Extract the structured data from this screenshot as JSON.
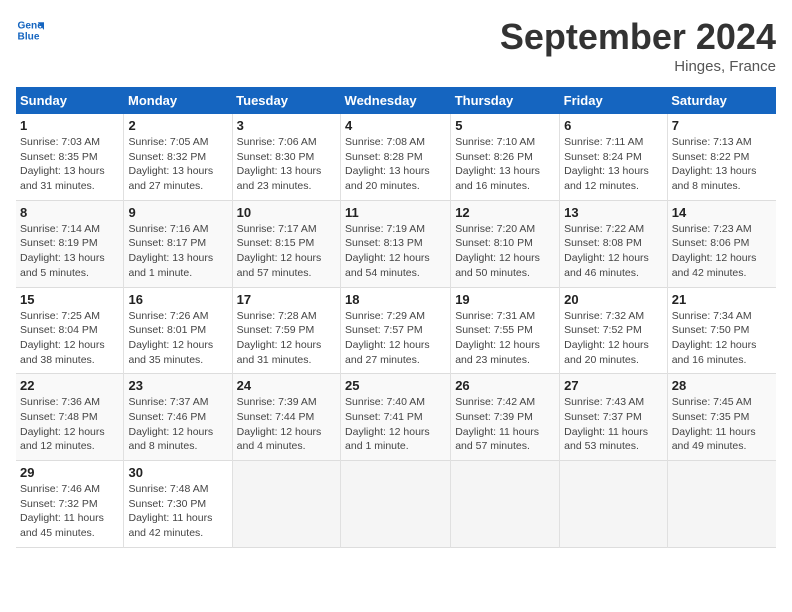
{
  "header": {
    "logo_line1": "General",
    "logo_line2": "Blue",
    "month": "September 2024",
    "location": "Hinges, France"
  },
  "days_of_week": [
    "Sunday",
    "Monday",
    "Tuesday",
    "Wednesday",
    "Thursday",
    "Friday",
    "Saturday"
  ],
  "weeks": [
    [
      {
        "day": "1",
        "info": "Sunrise: 7:03 AM\nSunset: 8:35 PM\nDaylight: 13 hours\nand 31 minutes."
      },
      {
        "day": "2",
        "info": "Sunrise: 7:05 AM\nSunset: 8:32 PM\nDaylight: 13 hours\nand 27 minutes."
      },
      {
        "day": "3",
        "info": "Sunrise: 7:06 AM\nSunset: 8:30 PM\nDaylight: 13 hours\nand 23 minutes."
      },
      {
        "day": "4",
        "info": "Sunrise: 7:08 AM\nSunset: 8:28 PM\nDaylight: 13 hours\nand 20 minutes."
      },
      {
        "day": "5",
        "info": "Sunrise: 7:10 AM\nSunset: 8:26 PM\nDaylight: 13 hours\nand 16 minutes."
      },
      {
        "day": "6",
        "info": "Sunrise: 7:11 AM\nSunset: 8:24 PM\nDaylight: 13 hours\nand 12 minutes."
      },
      {
        "day": "7",
        "info": "Sunrise: 7:13 AM\nSunset: 8:22 PM\nDaylight: 13 hours\nand 8 minutes."
      }
    ],
    [
      {
        "day": "8",
        "info": "Sunrise: 7:14 AM\nSunset: 8:19 PM\nDaylight: 13 hours\nand 5 minutes."
      },
      {
        "day": "9",
        "info": "Sunrise: 7:16 AM\nSunset: 8:17 PM\nDaylight: 13 hours\nand 1 minute."
      },
      {
        "day": "10",
        "info": "Sunrise: 7:17 AM\nSunset: 8:15 PM\nDaylight: 12 hours\nand 57 minutes."
      },
      {
        "day": "11",
        "info": "Sunrise: 7:19 AM\nSunset: 8:13 PM\nDaylight: 12 hours\nand 54 minutes."
      },
      {
        "day": "12",
        "info": "Sunrise: 7:20 AM\nSunset: 8:10 PM\nDaylight: 12 hours\nand 50 minutes."
      },
      {
        "day": "13",
        "info": "Sunrise: 7:22 AM\nSunset: 8:08 PM\nDaylight: 12 hours\nand 46 minutes."
      },
      {
        "day": "14",
        "info": "Sunrise: 7:23 AM\nSunset: 8:06 PM\nDaylight: 12 hours\nand 42 minutes."
      }
    ],
    [
      {
        "day": "15",
        "info": "Sunrise: 7:25 AM\nSunset: 8:04 PM\nDaylight: 12 hours\nand 38 minutes."
      },
      {
        "day": "16",
        "info": "Sunrise: 7:26 AM\nSunset: 8:01 PM\nDaylight: 12 hours\nand 35 minutes."
      },
      {
        "day": "17",
        "info": "Sunrise: 7:28 AM\nSunset: 7:59 PM\nDaylight: 12 hours\nand 31 minutes."
      },
      {
        "day": "18",
        "info": "Sunrise: 7:29 AM\nSunset: 7:57 PM\nDaylight: 12 hours\nand 27 minutes."
      },
      {
        "day": "19",
        "info": "Sunrise: 7:31 AM\nSunset: 7:55 PM\nDaylight: 12 hours\nand 23 minutes."
      },
      {
        "day": "20",
        "info": "Sunrise: 7:32 AM\nSunset: 7:52 PM\nDaylight: 12 hours\nand 20 minutes."
      },
      {
        "day": "21",
        "info": "Sunrise: 7:34 AM\nSunset: 7:50 PM\nDaylight: 12 hours\nand 16 minutes."
      }
    ],
    [
      {
        "day": "22",
        "info": "Sunrise: 7:36 AM\nSunset: 7:48 PM\nDaylight: 12 hours\nand 12 minutes."
      },
      {
        "day": "23",
        "info": "Sunrise: 7:37 AM\nSunset: 7:46 PM\nDaylight: 12 hours\nand 8 minutes."
      },
      {
        "day": "24",
        "info": "Sunrise: 7:39 AM\nSunset: 7:44 PM\nDaylight: 12 hours\nand 4 minutes."
      },
      {
        "day": "25",
        "info": "Sunrise: 7:40 AM\nSunset: 7:41 PM\nDaylight: 12 hours\nand 1 minute."
      },
      {
        "day": "26",
        "info": "Sunrise: 7:42 AM\nSunset: 7:39 PM\nDaylight: 11 hours\nand 57 minutes."
      },
      {
        "day": "27",
        "info": "Sunrise: 7:43 AM\nSunset: 7:37 PM\nDaylight: 11 hours\nand 53 minutes."
      },
      {
        "day": "28",
        "info": "Sunrise: 7:45 AM\nSunset: 7:35 PM\nDaylight: 11 hours\nand 49 minutes."
      }
    ],
    [
      {
        "day": "29",
        "info": "Sunrise: 7:46 AM\nSunset: 7:32 PM\nDaylight: 11 hours\nand 45 minutes."
      },
      {
        "day": "30",
        "info": "Sunrise: 7:48 AM\nSunset: 7:30 PM\nDaylight: 11 hours\nand 42 minutes."
      },
      {
        "day": "",
        "info": ""
      },
      {
        "day": "",
        "info": ""
      },
      {
        "day": "",
        "info": ""
      },
      {
        "day": "",
        "info": ""
      },
      {
        "day": "",
        "info": ""
      }
    ]
  ]
}
